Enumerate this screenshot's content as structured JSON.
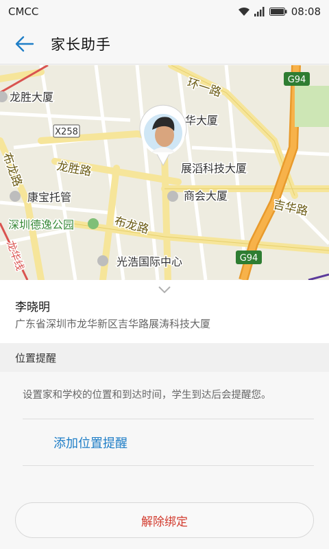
{
  "status_bar": {
    "carrier": "CMCC",
    "time": "08:08",
    "icons": [
      "wifi-icon",
      "signal-icon",
      "battery-icon"
    ]
  },
  "app_bar": {
    "title": "家长助手",
    "back_icon": "arrow-left-icon"
  },
  "map": {
    "labels": {
      "longsheng_building": "龙胜大厦",
      "huanyi_road": "环一路",
      "hua_building": "华大厦",
      "x258": "X258",
      "longsheng_road": "龙胜路",
      "zhandao_building": "展滔科技大厦",
      "longhua_road_vertical": "布龙路",
      "kangbao": "康宝托管",
      "shanghui_building": "商会大厦",
      "jihua_road": "吉华路",
      "deyi_park": "深圳德逸公园",
      "bulong_road": "布龙路",
      "guanghao": "光浩国际中心",
      "longhua_line": "龙华线",
      "g94_top": "G94",
      "g94_bottom": "G94"
    }
  },
  "person": {
    "name": "李晓明",
    "address": "广东省深圳市龙华新区吉华路展涛科技大厦"
  },
  "location_reminder": {
    "header": "位置提醒",
    "description": "设置家和学校的位置和到达时间，学生到达后会提醒您。",
    "add_link": "添加位置提醒"
  },
  "unbind_button": "解除绑定",
  "colors": {
    "accent": "#1f7ec7",
    "danger": "#d23c2f",
    "highway": "#f3a33a",
    "road_label": "#6a5a12"
  }
}
